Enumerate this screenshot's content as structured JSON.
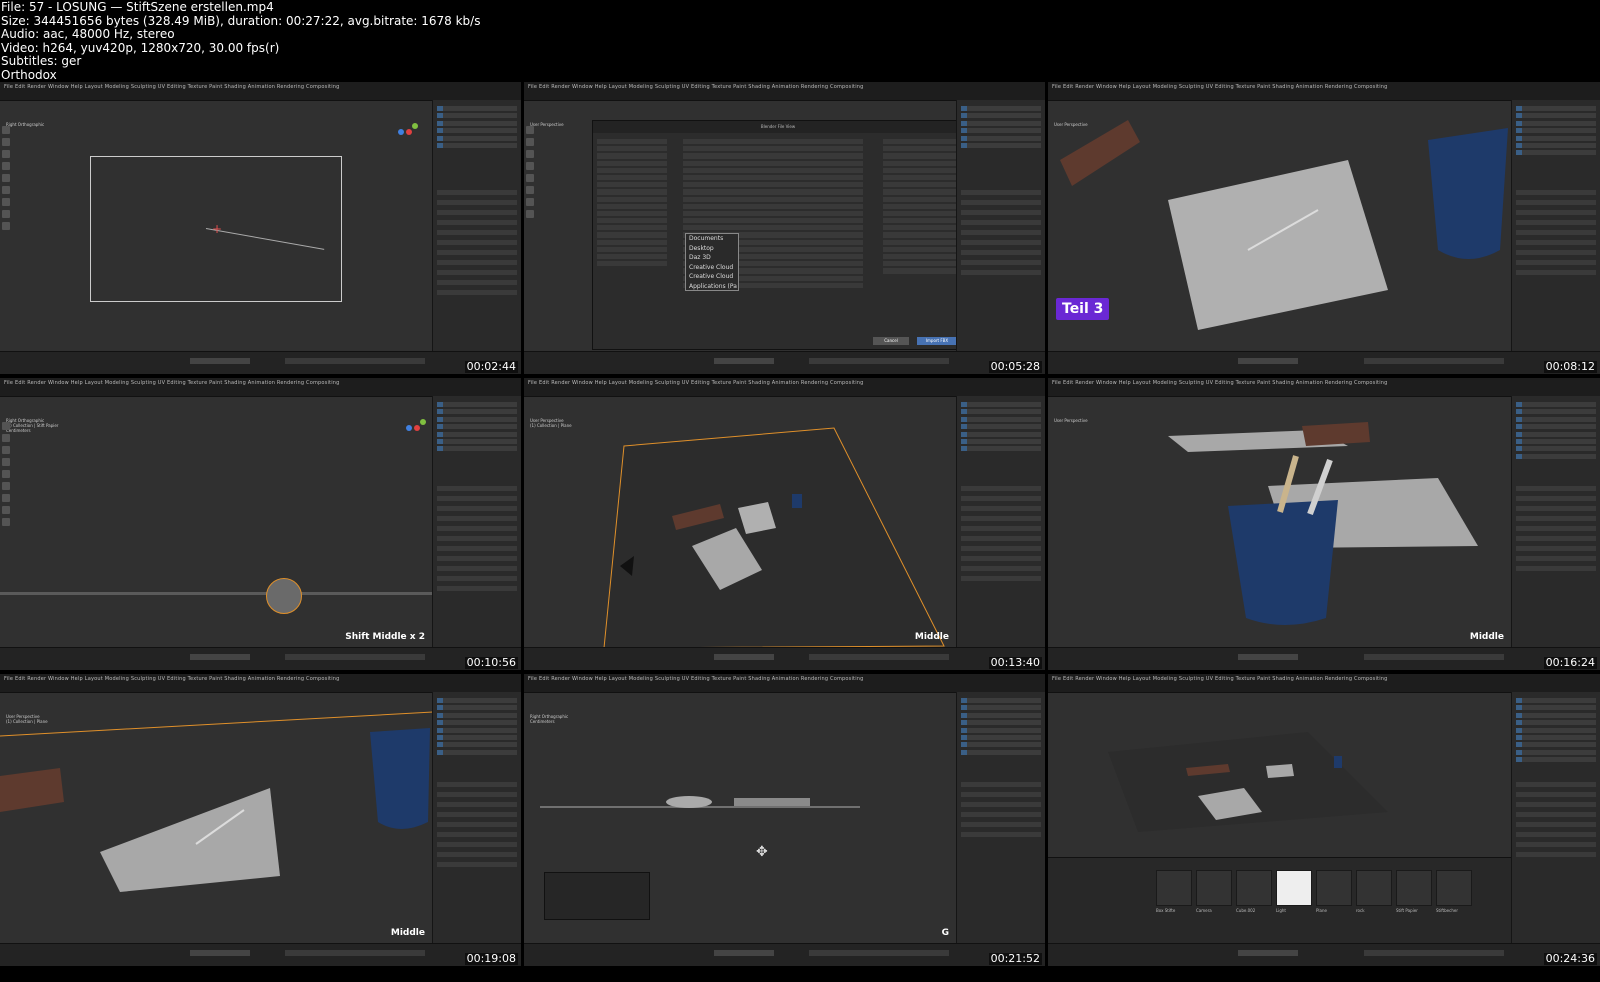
{
  "header": {
    "file": "File: 57 - LOSUNG — StiftSzene erstellen.mp4",
    "size": "Size: 344451656 bytes (328.49 MiB), duration: 00:27:22, avg.bitrate: 1678 kb/s",
    "audio": "Audio: aac, 48000 Hz, stereo",
    "video": "Video: h264, yuv420p, 1280x720, 30.00 fps(r)",
    "subtitles": "Subtitles: ger",
    "uploader": "Orthodox"
  },
  "app_menu": "File  Edit  Render  Window  Help     Layout  Modeling  Sculpting  UV Editing  Texture Paint  Shading  Animation  Rendering  Compositing",
  "viewport_info": {
    "user_perspective": "User Perspective",
    "right_ortho": "Right Orthographic",
    "collection_plane": "(1) Collection | Plane",
    "collection_stift": "(1) Collection | Stift Papier",
    "centimeters": "Centimeters"
  },
  "thumbs": [
    {
      "time": "00:02:44",
      "caption": ""
    },
    {
      "time": "00:05:28",
      "caption": ""
    },
    {
      "time": "00:08:12",
      "caption": "Teil 3"
    },
    {
      "time": "00:10:56",
      "caption": "Shift Middle x 2"
    },
    {
      "time": "00:13:40",
      "caption": "Middle"
    },
    {
      "time": "00:16:24",
      "caption": "Middle"
    },
    {
      "time": "00:19:08",
      "caption": "Middle"
    },
    {
      "time": "00:21:52",
      "caption": "G"
    },
    {
      "time": "00:24:36",
      "caption": ""
    }
  ],
  "file_browser": {
    "title": "Blender File View",
    "folders": [
      "Documents",
      "Desktop",
      "Daz 3D",
      "Creative Cloud",
      "Creative Cloud",
      "Applications (Pa"
    ],
    "import_button": "Import FBX",
    "cancel_button": "Cancel"
  },
  "asset_browser": {
    "items": [
      "Box Stifte",
      "Camera",
      "Cube.002",
      "Light",
      "Plane",
      "rock",
      "Stift Papier",
      "Stiftbecher"
    ]
  },
  "colors": {
    "blender_bg": "#303030",
    "paper": "#a8a8a8",
    "cup_blue": "#1e3a6a",
    "box_brown": "#5e3a2e",
    "teil_badge": "#6a28d4",
    "selected_orange": "#e0902a"
  }
}
